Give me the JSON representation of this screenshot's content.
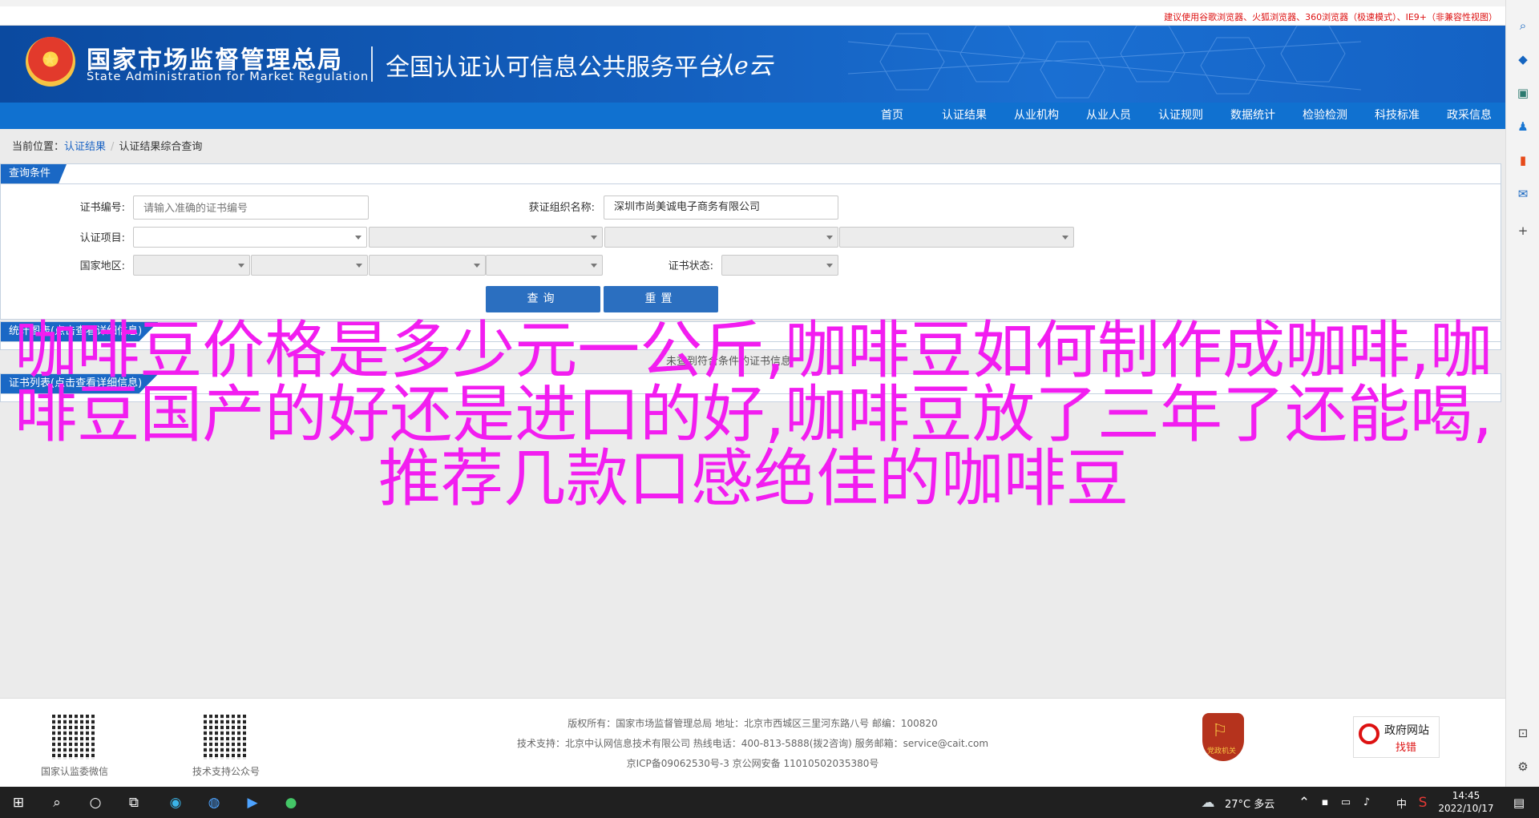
{
  "top_tip": "建议使用谷歌浏览器、火狐浏览器、360浏览器（极速模式）、IE9+（非兼容性视图）",
  "header": {
    "org_cn": "国家市场监督管理总局",
    "org_en": "State Administration  for  Market Regulation",
    "platform": "全国认证认可信息公共服务平台",
    "logo_text": "认e云"
  },
  "nav": [
    "首页",
    "认证结果",
    "从业机构",
    "从业人员",
    "认证规则",
    "数据统计",
    "检验检测",
    "科技标准",
    "政采信息"
  ],
  "breadcrumb": {
    "prefix": "当前位置：",
    "link": "认证结果",
    "current": "认证结果综合查询"
  },
  "query_panel": {
    "title": "查询条件",
    "cert_no_label": "证书编号:",
    "cert_no_placeholder": "请输入准确的证书编号",
    "org_name_label": "获证组织名称:",
    "org_name_value": "深圳市尚美诚电子商务有限公司",
    "cert_item_label": "认证项目:",
    "region_label": "国家地区:",
    "status_label": "证书状态:",
    "query_button": "查询",
    "reset_button": "重置"
  },
  "stats_panel": {
    "title": "统计图表(点击查看详细信息)",
    "note": "未查到符合条件的证书信息"
  },
  "list_panel": {
    "title": "证书列表(点击查看详细信息)"
  },
  "overlay_text": "咖啡豆价格是多少元一公斤,咖啡豆如何制作成咖啡,咖啡豆国产的好还是进口的好,咖啡豆放了三年了还能喝,推荐几款口感绝佳的咖啡豆",
  "footer": {
    "qr1_caption": "国家认监委微信",
    "qr2_caption": "技术支持公众号",
    "line1": "版权所有：国家市场监督管理总局    地址：北京市西城区三里河东路八号    邮编：100820",
    "line2": "技术支持：北京中认网信息技术有限公司    热线电话：400-813-5888(拨2咨询)    服务邮箱：service@cait.com",
    "line3": "京ICP备09062530号-3    京公网安备 11010502035380号",
    "badge_text": "党政机关",
    "zfwz_title": "政府网站",
    "zfwz_sub": "找错"
  },
  "taskbar": {
    "weather": "27°C  多云",
    "ime": "中",
    "time": "14:45",
    "date": "2022/10/17"
  },
  "colors": {
    "header_blue": "#1460bf",
    "nav_blue": "#1071d0",
    "overlay_magenta": "#f21df0"
  }
}
